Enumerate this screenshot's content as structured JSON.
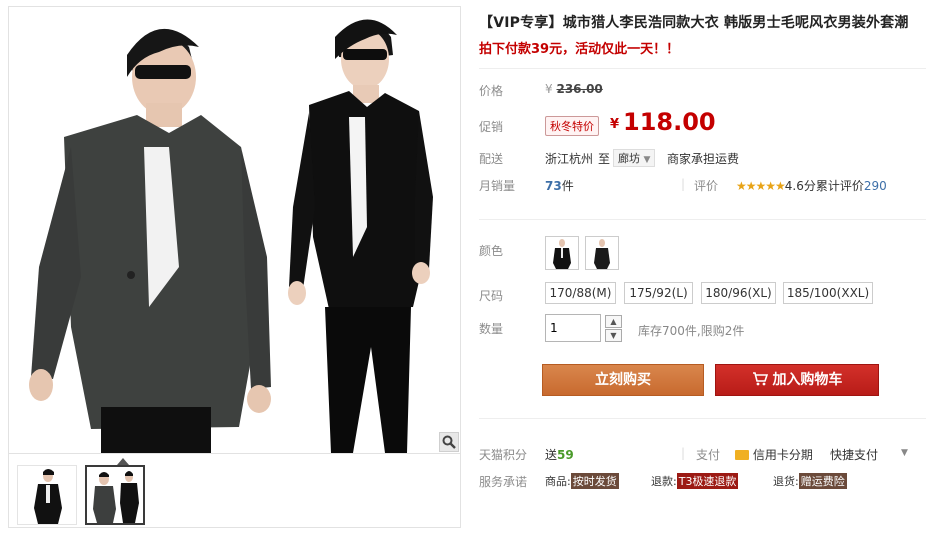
{
  "product": {
    "title": "【VIP专享】城市猎人李民浩同款大衣 韩版男士毛呢风衣男装外套潮",
    "subtitle": "拍下付款39元，活动仅此一天！！"
  },
  "price": {
    "label": "价格",
    "currency": "¥",
    "original": "236.00"
  },
  "promo": {
    "label": "促销",
    "badge": "秋冬特价",
    "currency": "¥",
    "price": "118.00"
  },
  "shipping": {
    "label": "配送",
    "from": "浙江杭州",
    "to_word": "至",
    "destination": "廊坊",
    "note": "商家承担运费"
  },
  "sales": {
    "label": "月销量",
    "count": "73",
    "unit": "件",
    "rating_label": "评价",
    "stars": "★★★★★",
    "score": "4.6分",
    "reviews_label": "累计评价",
    "reviews": "290"
  },
  "color": {
    "label": "颜色",
    "options": [
      "black-front",
      "black-side"
    ]
  },
  "size": {
    "label": "尺码",
    "options": [
      "170/88(M)",
      "175/92(L)",
      "180/96(XL)",
      "185/100(XXL)"
    ]
  },
  "quantity": {
    "label": "数量",
    "value": "1",
    "stock_note": "库存700件,限购2件"
  },
  "actions": {
    "buy_now": "立刻购买",
    "add_to_cart": "加入购物车"
  },
  "points": {
    "label": "天猫积分",
    "prefix": "送",
    "value": "59",
    "pay_label": "支付",
    "installment": "信用卡分期",
    "fast_pay": "快捷支付"
  },
  "service": {
    "label": "服务承诺",
    "goods_prefix": "商品:",
    "goods_tag": "按时发货",
    "refund_prefix": "退款:",
    "refund_tag": "T3极速退款",
    "return_prefix": "退货:",
    "return_tag": "赠运费险"
  },
  "colors": {
    "accent": "#c40000",
    "buy_button": "#c86a2f",
    "cart_button": "#b81c18",
    "link_blue": "#3d6fa8",
    "star": "#e8a317"
  }
}
